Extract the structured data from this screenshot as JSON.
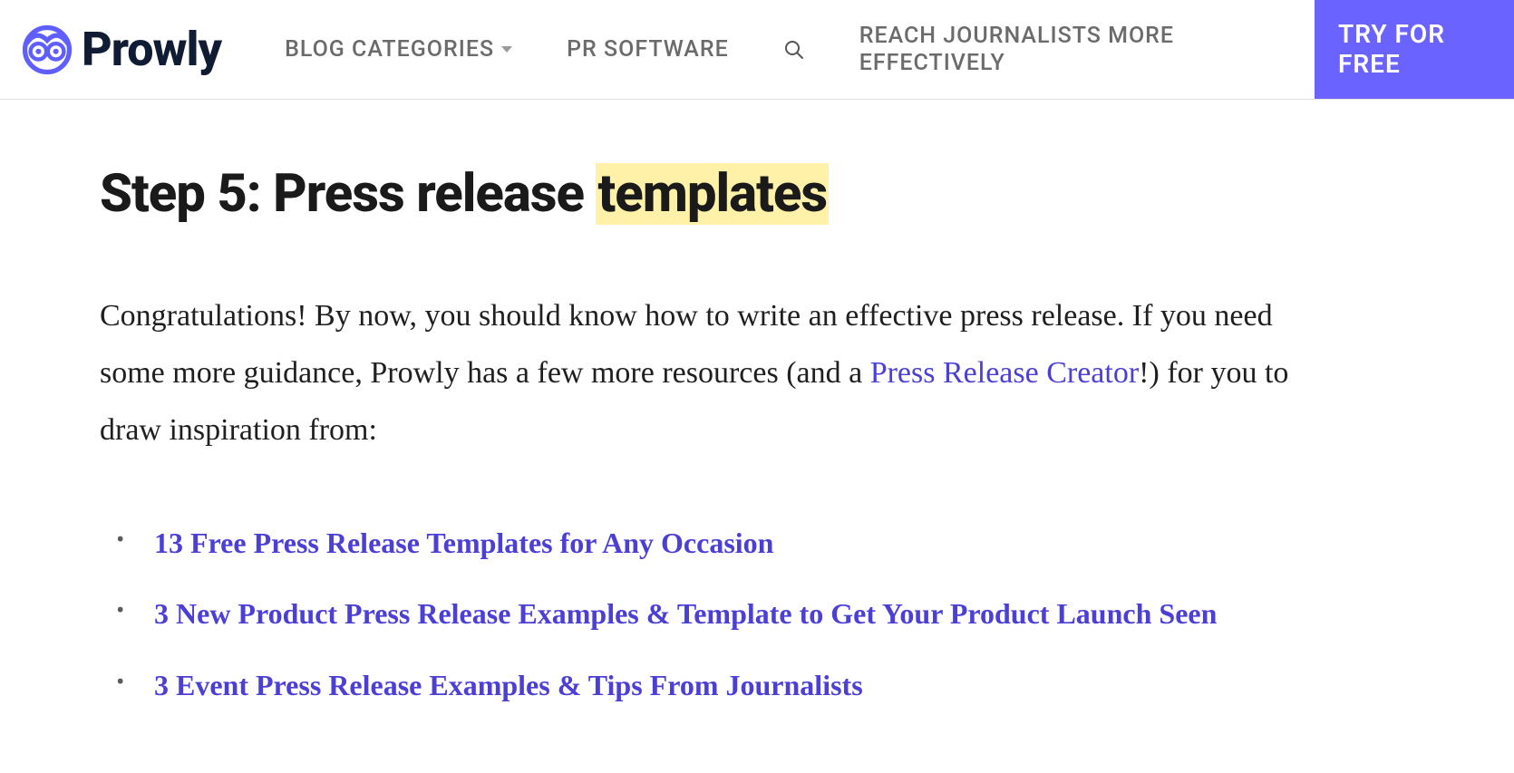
{
  "header": {
    "logo_text": "Prowly",
    "nav": {
      "categories": "BLOG CATEGORIES",
      "software": "PR SOFTWARE",
      "reach": "REACH JOURNALISTS MORE EFFECTIVELY"
    },
    "cta": "TRY FOR FREE"
  },
  "content": {
    "heading_prefix": "Step 5: Press release ",
    "heading_highlight": "templates",
    "intro_1": "Congratulations! By now, you should know how to write an effective press release. If you need some more guidance, Prowly has a few more resources (and a ",
    "intro_link": "Press Release Creator",
    "intro_2": "!) for you to draw inspiration from:",
    "links": [
      "13 Free Press Release Templates for Any Occasion",
      "3 New Product Press Release Examples & Template to Get Your Product Launch Seen",
      "3 Event Press Release Examples & Tips From Journalists"
    ]
  }
}
